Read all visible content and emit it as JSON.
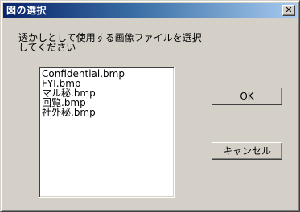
{
  "window": {
    "title": "図の選択",
    "close_glyph": "✕",
    "close_icon": "close-icon"
  },
  "prompt": {
    "line1": "透かしとして使用する画像ファイルを選択",
    "line2": "してください"
  },
  "file_list": {
    "items": [
      "Confidential.bmp",
      "FYI.bmp",
      "マル秘.bmp",
      "回覧.bmp",
      "社外秘.bmp"
    ]
  },
  "buttons": {
    "ok_label": "OK",
    "cancel_label": "キャンセル"
  },
  "colors": {
    "dialog_face": "#d4d0c8",
    "titlebar_start": "#0a246a",
    "titlebar_end": "#a6caf0",
    "list_background": "#ffffff"
  }
}
